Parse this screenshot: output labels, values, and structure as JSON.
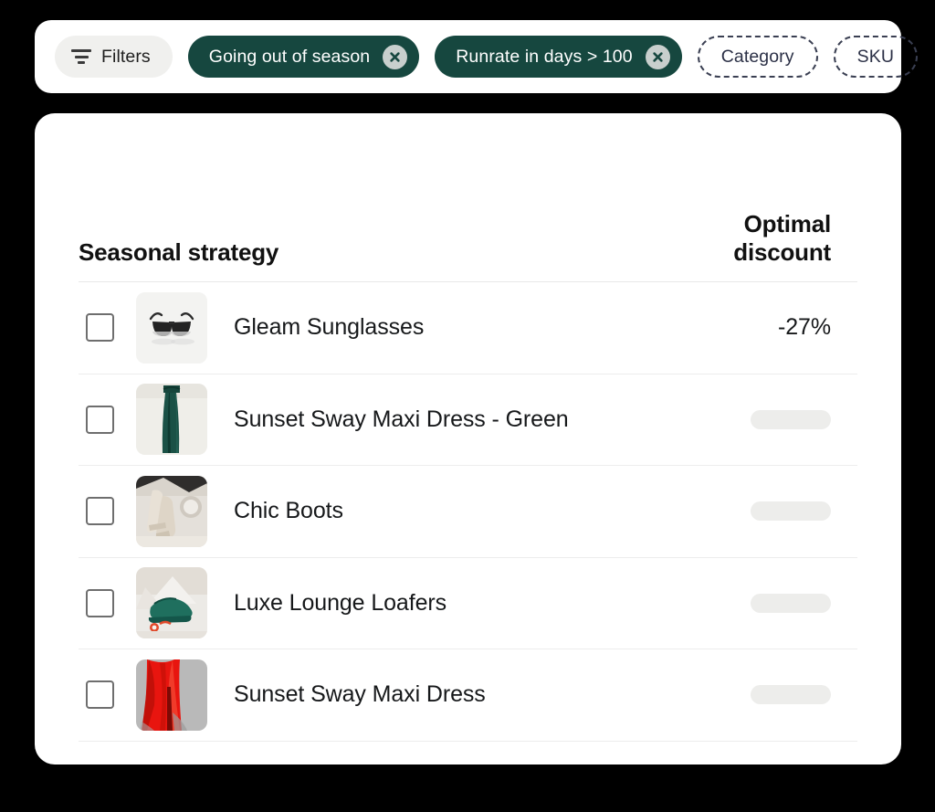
{
  "filter_bar": {
    "filters_button": {
      "label": "Filters",
      "icon": "filter-icon"
    },
    "active_chips": [
      {
        "label": "Going out of season",
        "remove_icon": "close-circle-icon"
      },
      {
        "label": "Runrate in days > 100",
        "remove_icon": "close-circle-icon"
      }
    ],
    "add_chips": [
      {
        "label": "Category"
      },
      {
        "label": "SKU"
      }
    ],
    "colors": {
      "active_chip_bg": "#16473f",
      "active_chip_text": "#ffffff",
      "filters_chip_bg": "#f0f0ee",
      "dashed_chip_text": "#2b3046"
    }
  },
  "table": {
    "columns": [
      {
        "key": "name",
        "label": "Seasonal strategy",
        "align": "left"
      },
      {
        "key": "discount",
        "label": "Optimal discount",
        "align": "right"
      }
    ],
    "rows": [
      {
        "selected": false,
        "name": "Gleam Sunglasses",
        "thumb": "sunglasses-thumbnail",
        "discount": "-27%",
        "discount_loading": false
      },
      {
        "selected": false,
        "name": "Sunset Sway Maxi Dress - Green",
        "thumb": "green-dress-thumbnail",
        "discount": "",
        "discount_loading": true
      },
      {
        "selected": false,
        "name": "Chic Boots",
        "thumb": "boots-thumbnail",
        "discount": "",
        "discount_loading": true
      },
      {
        "selected": false,
        "name": "Luxe Lounge Loafers",
        "thumb": "loafers-thumbnail",
        "discount": "",
        "discount_loading": true
      },
      {
        "selected": false,
        "name": "Sunset Sway Maxi Dress",
        "thumb": "red-dress-thumbnail",
        "discount": "",
        "discount_loading": true
      }
    ]
  }
}
